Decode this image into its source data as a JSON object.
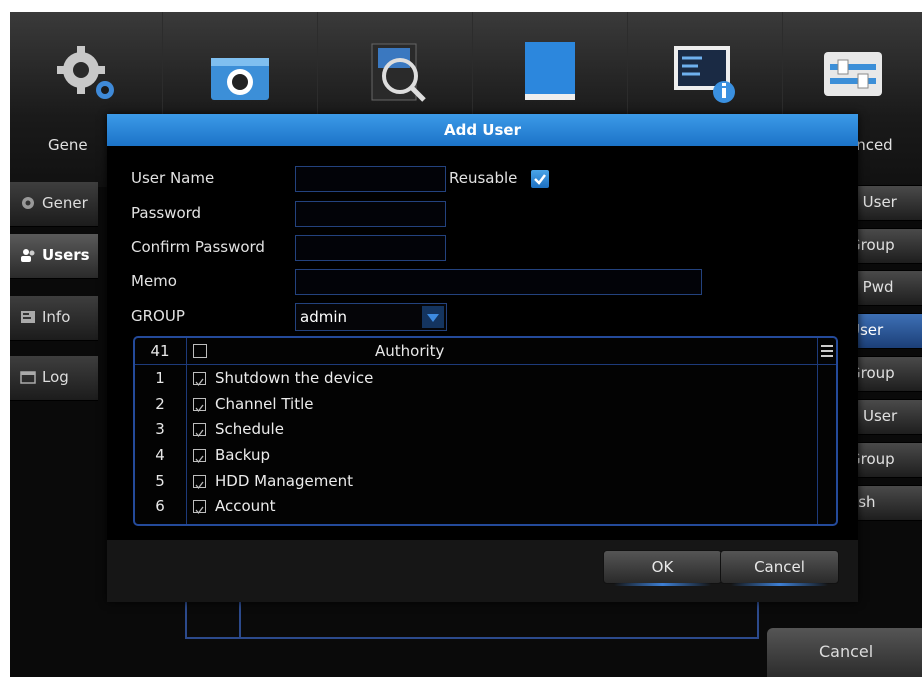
{
  "toolbar": {
    "left_label": "Gene",
    "right_label": "anced",
    "icons": [
      "gear-icon",
      "camera-icon",
      "search-video-icon",
      "storage-icon",
      "info-icon",
      "advanced-icon"
    ]
  },
  "sidemenu": {
    "items": [
      {
        "label": "Gener",
        "icon": "gear-icon"
      },
      {
        "label": "Users",
        "icon": "users-icon",
        "active": true
      },
      {
        "label": "Info",
        "icon": "info-icon"
      },
      {
        "label": "Log",
        "icon": "calendar-icon"
      }
    ]
  },
  "rightmenu": {
    "items": [
      {
        "label": "y User"
      },
      {
        "label": "Group"
      },
      {
        "label": "y Pwd"
      },
      {
        "label": "User",
        "selected": true
      },
      {
        "label": "Group"
      },
      {
        "label": "e User"
      },
      {
        "label": "Group"
      },
      {
        "label": "esh"
      }
    ]
  },
  "background": {
    "cancel_label": "Cancel"
  },
  "dialog": {
    "title": "Add User",
    "user_name_label": "User Name",
    "reusable_label": "Reusable",
    "reusable_checked": true,
    "password_label": "Password",
    "confirm_password_label": "Confirm Password",
    "memo_label": "Memo",
    "group_label": "GROUP",
    "group_value": "admin",
    "table": {
      "count": "41",
      "header": "Authority",
      "rows": [
        {
          "num": "1",
          "label": "Shutdown the device",
          "checked": true
        },
        {
          "num": "2",
          "label": "Channel Title",
          "checked": true
        },
        {
          "num": "3",
          "label": "Schedule",
          "checked": true
        },
        {
          "num": "4",
          "label": "Backup",
          "checked": true
        },
        {
          "num": "5",
          "label": "HDD Management",
          "checked": true
        },
        {
          "num": "6",
          "label": "Account",
          "checked": true
        }
      ]
    },
    "ok_label": "OK",
    "cancel_label": "Cancel"
  },
  "colors": {
    "accent": "#1f78cc",
    "border": "#23427e"
  }
}
